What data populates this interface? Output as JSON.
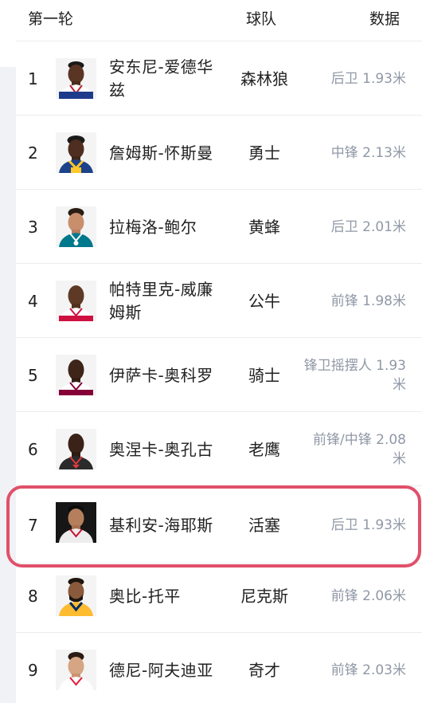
{
  "header": {
    "round_label": "第一轮",
    "team_label": "球队",
    "data_label": "数据"
  },
  "rows": [
    {
      "pick": "1",
      "name": "安东尼-爱德华兹",
      "team": "森林狼",
      "info": "后卫 1.93米"
    },
    {
      "pick": "2",
      "name": "詹姆斯-怀斯曼",
      "team": "勇士",
      "info": "中锋 2.13米"
    },
    {
      "pick": "3",
      "name": "拉梅洛-鲍尔",
      "team": "黄蜂",
      "info": "后卫 2.01米"
    },
    {
      "pick": "4",
      "name": "帕特里克-威廉姆斯",
      "team": "公牛",
      "info": "前锋 1.98米"
    },
    {
      "pick": "5",
      "name": "伊萨卡-奥科罗",
      "team": "骑士",
      "info": "锋卫摇摆人 1.93米"
    },
    {
      "pick": "6",
      "name": "奥涅卡-奥孔古",
      "team": "老鹰",
      "info": "前锋/中锋 2.08米"
    },
    {
      "pick": "7",
      "name": "基利安-海耶斯",
      "team": "活塞",
      "info": "后卫 1.93米"
    },
    {
      "pick": "8",
      "name": "奥比-托平",
      "team": "尼克斯",
      "info": "前锋 2.06米"
    },
    {
      "pick": "9",
      "name": "德尼-阿夫迪亚",
      "team": "奇才",
      "info": "前锋 2.03米"
    }
  ],
  "highlighted_row": "7",
  "colors": {
    "highlight_border": "#e0506a",
    "info_text": "#9098a6",
    "divider": "#ececec"
  }
}
